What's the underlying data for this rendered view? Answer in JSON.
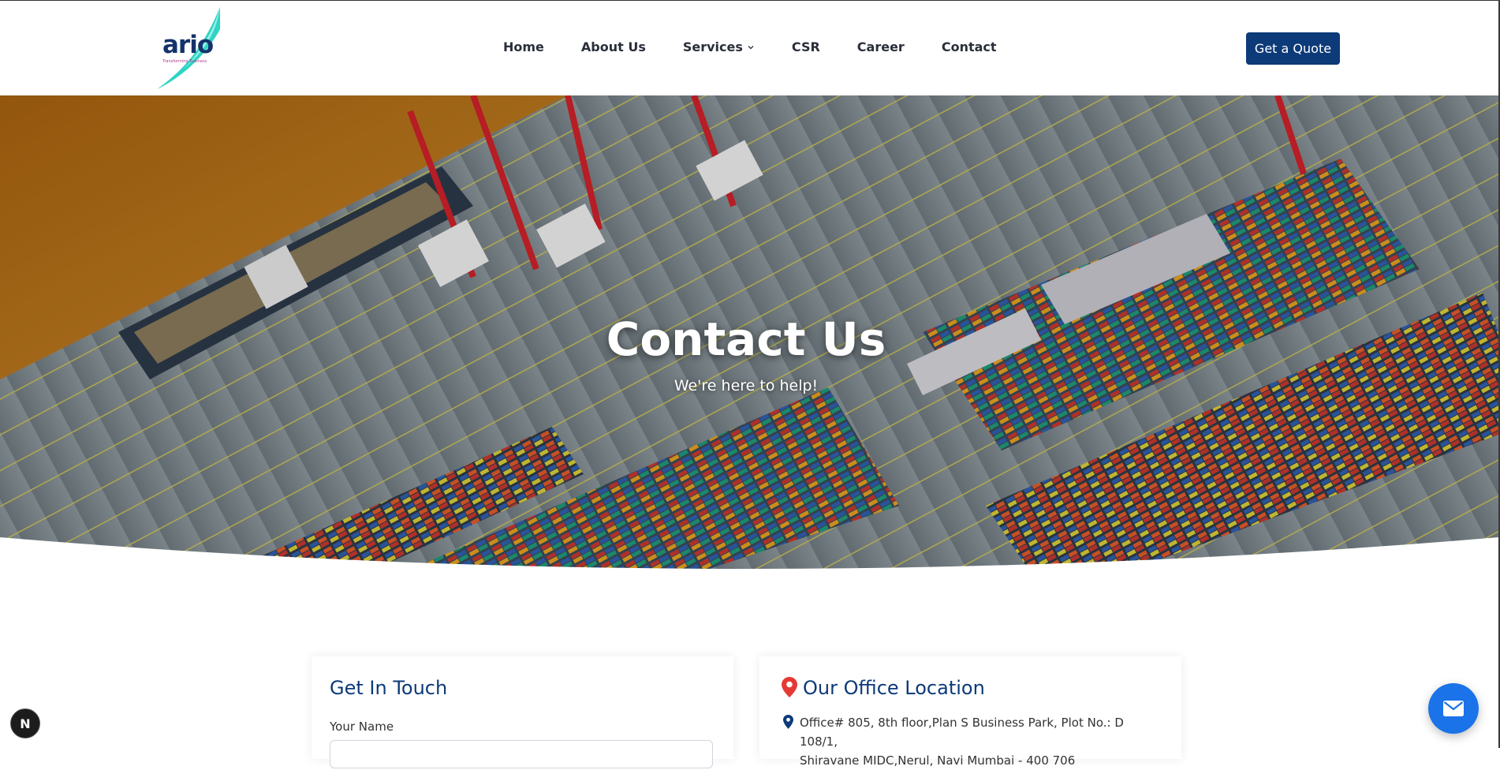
{
  "header": {
    "logo_text": "ario",
    "logo_tagline": "Transforming Business",
    "nav": [
      {
        "label": "Home"
      },
      {
        "label": "About Us"
      },
      {
        "label": "Services"
      },
      {
        "label": "CSR"
      },
      {
        "label": "Career"
      },
      {
        "label": "Contact"
      }
    ],
    "cta_label": "Get a Quote"
  },
  "hero": {
    "title": "Contact Us",
    "subtitle": "We're here to help!"
  },
  "contact_form": {
    "title": "Get In Touch",
    "name_label": "Your Name",
    "name_value": ""
  },
  "office": {
    "title": "Our Office Location",
    "address_line1": "Office# 805, 8th floor,Plan S Business Park, Plot No.: D 108/1,",
    "address_line2": "Shiravane MIDC,Nerul, Navi Mumbai - 400 706"
  },
  "floating": {
    "badge_letter": "N"
  },
  "colors": {
    "brand_navy": "#0d3a78",
    "brand_teal": "#2fd4c4",
    "pin_red": "#e53935",
    "fab_blue": "#1a73e8"
  },
  "icons": [
    "chevron-down-icon",
    "location-pin-icon",
    "map-marker-icon",
    "mail-icon"
  ]
}
